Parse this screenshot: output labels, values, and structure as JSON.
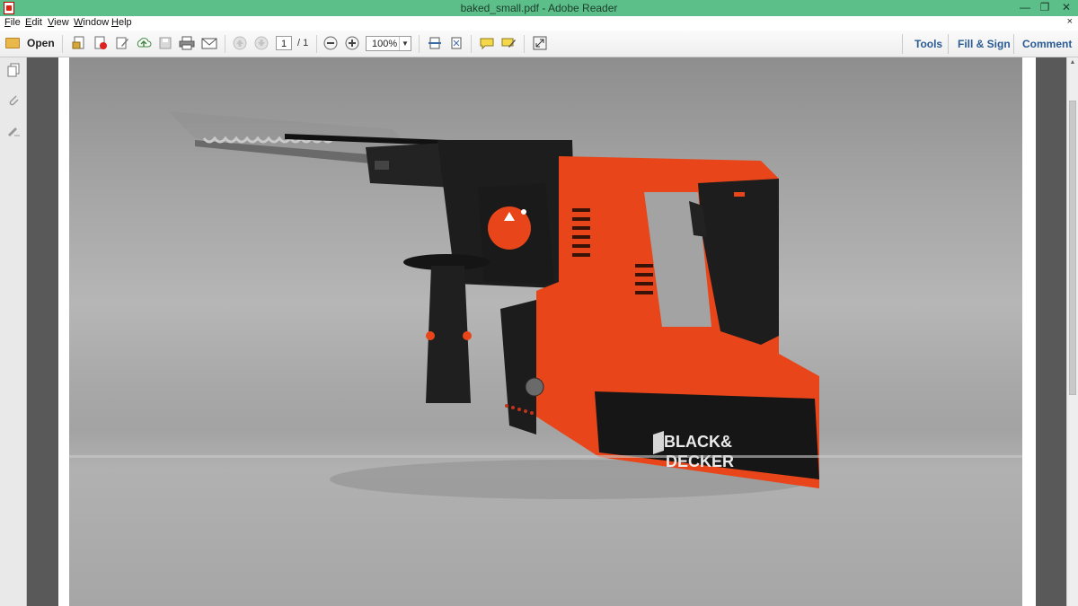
{
  "window": {
    "title": "baked_small.pdf - Adobe Reader",
    "minimize_glyph": "—",
    "restore_glyph": "❐",
    "close_glyph": "✕"
  },
  "menu": {
    "items": [
      "File",
      "Edit",
      "View",
      "Window",
      "Help"
    ],
    "doc_close": "×"
  },
  "toolbar": {
    "open_label": "Open",
    "page_current": "1",
    "page_total": "/ 1",
    "zoom_value": "100%",
    "right_tabs": [
      "Tools",
      "Fill & Sign",
      "Comment"
    ]
  },
  "document": {
    "brand_text_line1": "BLACK&",
    "brand_text_line2": "DECKER"
  },
  "colors": {
    "titlebar": "#5cbf8a",
    "tab_text": "#2a5b94",
    "drill_orange": "#e8461a",
    "drill_black": "#1d1d1d"
  }
}
